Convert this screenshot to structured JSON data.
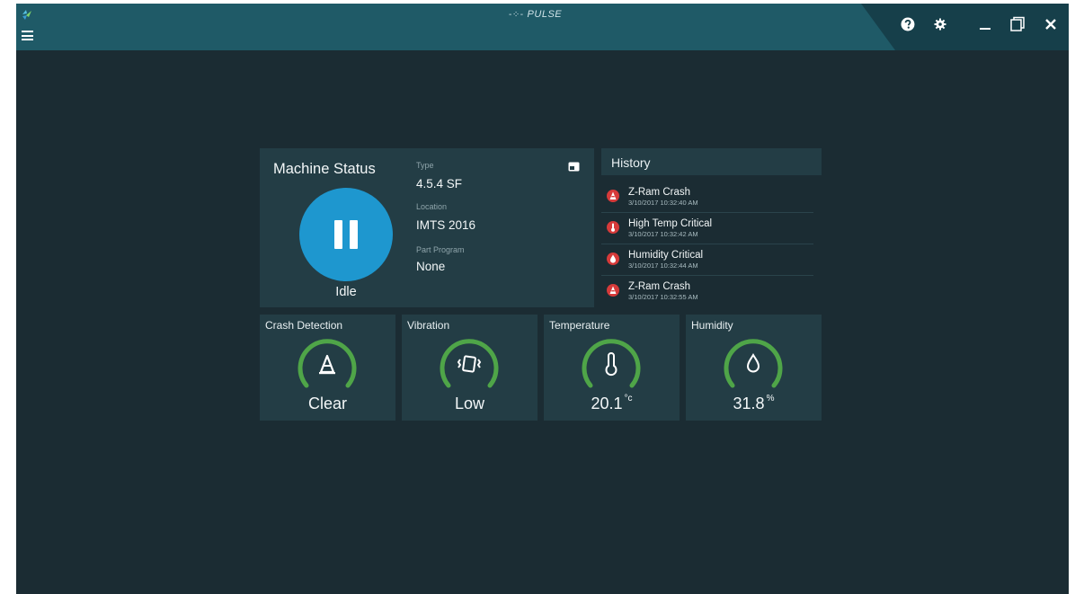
{
  "app": {
    "title": "PULSE",
    "title_decoration": "-⁘-"
  },
  "window_controls": {
    "help_icon": "help-circle-icon",
    "settings_icon": "gear-icon",
    "minimize_icon": "minimize-icon",
    "restore_icon": "restore-icon",
    "close_icon": "close-icon"
  },
  "machine_status": {
    "title": "Machine Status",
    "state": "Idle",
    "type_label": "Type",
    "type_value": "4.5.4 SF",
    "location_label": "Location",
    "location_value": "IMTS 2016",
    "program_label": "Part Program",
    "program_value": "None"
  },
  "history": {
    "title": "History",
    "items": [
      {
        "name": "Z-Ram Crash",
        "time": "3/10/2017 10:32:40 AM",
        "icon": "crash-icon"
      },
      {
        "name": "High Temp Critical",
        "time": "3/10/2017 10:32:42 AM",
        "icon": "thermometer-icon"
      },
      {
        "name": "Humidity Critical",
        "time": "3/10/2017 10:32:44 AM",
        "icon": "droplet-icon"
      },
      {
        "name": "Z-Ram Crash",
        "time": "3/10/2017 10:32:55 AM",
        "icon": "crash-icon"
      }
    ]
  },
  "sensors": {
    "crash": {
      "name": "Crash Detection",
      "value": "Clear",
      "unit": ""
    },
    "vibration": {
      "name": "Vibration",
      "value": "Low",
      "unit": ""
    },
    "temperature": {
      "name": "Temperature",
      "value": "20.1",
      "unit": "°c"
    },
    "humidity": {
      "name": "Humidity",
      "value": "31.8",
      "unit": "%"
    }
  },
  "colors": {
    "titlebar": "#1f5a67",
    "background": "#1b2c33",
    "panel": "#233d45",
    "accent_blue": "#1e97cf",
    "gauge_green": "#4fa548",
    "alert_red": "#d63a3a"
  }
}
